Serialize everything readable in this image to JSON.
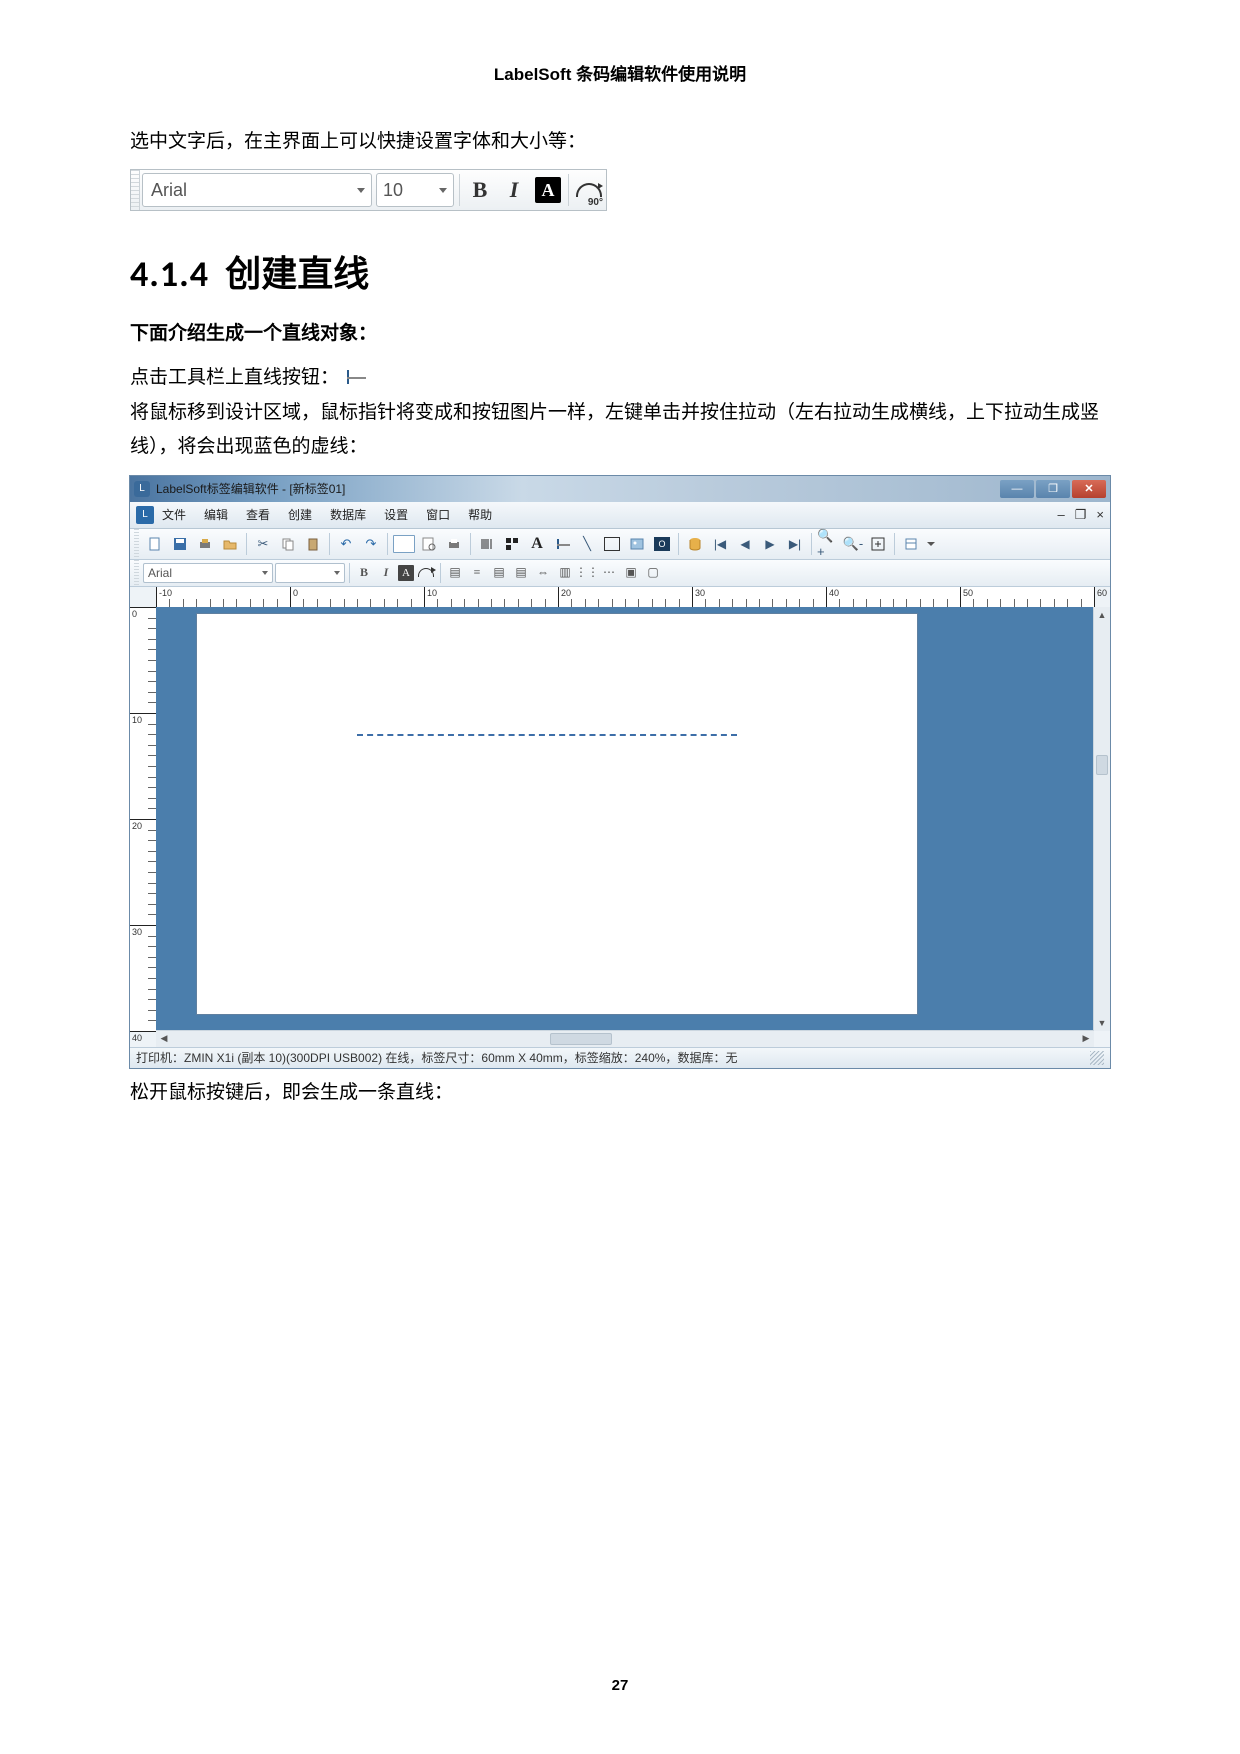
{
  "doc_header": "LabelSoft 条码编辑软件使用说明",
  "page_number": "27",
  "para1": "选中文字后，在主界面上可以快捷设置字体和大小等：",
  "fig1_toolbar": {
    "font_name": "Arial",
    "font_size": "10",
    "bold_glyph": "B",
    "italic_glyph": "I",
    "invert_glyph": "A",
    "rotate_label": "90°"
  },
  "section_number": "4.1.4",
  "section_title": "创建直线",
  "para_bold": "下面介绍生成一个直线对象：",
  "para_toolbtn": "点击工具栏上直线按钮：",
  "para_drag": "将鼠标移到设计区域，鼠标指针将变成和按钮图片一样，左键单击并按住拉动（左右拉动生成横线，上下拉动生成竖线），将会出现蓝色的虚线：",
  "appwin": {
    "title": "LabelSoft标签编辑软件 - [新标签01]",
    "menus": [
      "文件",
      "编辑",
      "查看",
      "创建",
      "数据库",
      "设置",
      "窗口",
      "帮助"
    ],
    "mdi_controls": [
      "–",
      "❐",
      "×"
    ],
    "fmt_font": "Arial",
    "fmt_size": "",
    "fmt_bold": "B",
    "fmt_italic": "I",
    "fmt_invert": "A",
    "hruler_marks": [
      "-10",
      "0",
      "10",
      "20",
      "30",
      "40",
      "50",
      "60"
    ],
    "vruler_marks": [
      "0",
      "10",
      "20",
      "30",
      "40"
    ],
    "statusbar": "打印机：ZMIN X1i (副本 10)(300DPI USB002) 在线，标签尺寸：60mm X 40mm，标签缩放：240%，数据库：无"
  },
  "para_release": "松开鼠标按键后，即会生成一条直线："
}
